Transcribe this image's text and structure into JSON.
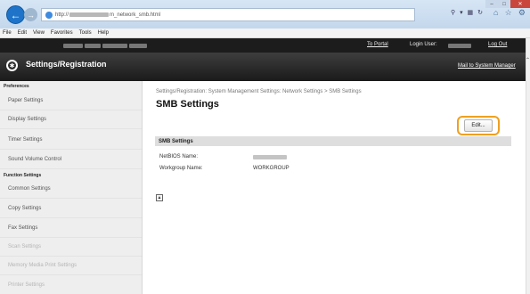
{
  "browser": {
    "url_visible_prefix": "http://",
    "url_visible_suffix": "m_network_smb.html",
    "menu": [
      "File",
      "Edit",
      "View",
      "Favorites",
      "Tools",
      "Help"
    ]
  },
  "header": {
    "portal_link": "To Portal",
    "login_user_label": "Login User:",
    "logout_link": "Log Out",
    "app_title": "Settings/Registration",
    "mail_link": "Mail to System Manager"
  },
  "sidebar": {
    "preferences_head": "Preferences",
    "preferences": [
      "Paper Settings",
      "Display Settings",
      "Timer Settings",
      "Sound Volume Control"
    ],
    "function_head": "Function Settings",
    "functions": [
      "Common Settings",
      "Copy Settings",
      "Fax Settings",
      "Scan Settings",
      "Memory Media Print Settings",
      "Printer Settings"
    ]
  },
  "main": {
    "breadcrumb": "Settings/Registration: System Management Settings: Network Settings > SMB Settings",
    "title": "SMB Settings",
    "edit_label": "Edit...",
    "section_title": "SMB Settings",
    "netbios_label": "NetBIOS Name:",
    "workgroup_label": "Workgroup Name:",
    "workgroup_value": "WORKGROUP"
  },
  "colors": {
    "highlight": "#f0a020",
    "header_dark": "#1c1c1c",
    "back_button": "#1f74c9"
  }
}
